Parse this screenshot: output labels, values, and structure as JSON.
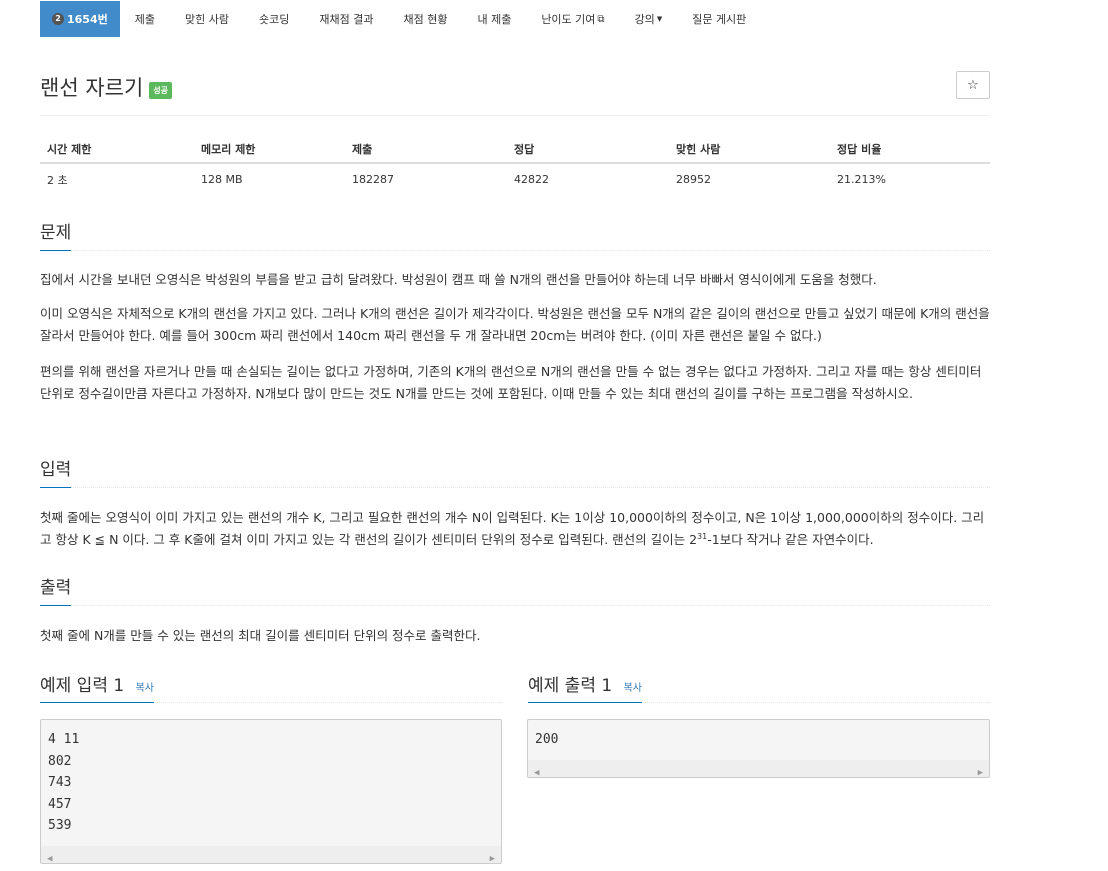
{
  "nav": {
    "problem_number": "1654번",
    "badge_icon": "tier-badge-icon",
    "items": [
      "제출",
      "맞힌 사람",
      "숏코딩",
      "재채점 결과",
      "채점 현황",
      "내 제출",
      "난이도 기여",
      "강의",
      "질문 게시판"
    ]
  },
  "title": "랜선 자르기",
  "status_label": "성공",
  "star_icon": "☆",
  "info": {
    "headers": [
      "시간 제한",
      "메모리 제한",
      "제출",
      "정답",
      "맞힌 사람",
      "정답 비율"
    ],
    "values": [
      "2 초",
      "128 MB",
      "182287",
      "42822",
      "28952",
      "21.213%"
    ]
  },
  "sections": {
    "problem": "문제",
    "input": "입력",
    "output": "출력"
  },
  "problem_paragraphs": [
    "집에서 시간을 보내던 오영식은 박성원의 부름을 받고 급히 달려왔다. 박성원이 캠프 때 쓸 N개의 랜선을 만들어야 하는데 너무 바빠서 영식이에게 도움을 청했다.",
    "이미 오영식은 자체적으로 K개의 랜선을 가지고 있다. 그러나 K개의 랜선은 길이가 제각각이다. 박성원은 랜선을 모두 N개의 같은 길이의 랜선으로 만들고 싶었기 때문에 K개의 랜선을 잘라서 만들어야 한다. 예를 들어 300cm 짜리 랜선에서 140cm 짜리 랜선을 두 개 잘라내면 20cm는 버려야 한다. (이미 자른 랜선은 붙일 수 없다.)",
    "편의를 위해 랜선을 자르거나 만들 때 손실되는 길이는 없다고 가정하며, 기존의 K개의 랜선으로 N개의 랜선을 만들 수 없는 경우는 없다고 가정하자. 그리고 자를 때는 항상 센티미터 단위로 정수길이만큼 자른다고 가정하자. N개보다 많이 만드는 것도 N개를 만드는 것에 포함된다. 이때 만들 수 있는 최대 랜선의 길이를 구하는 프로그램을 작성하시오."
  ],
  "input_text": {
    "before_sup": "첫째 줄에는 오영식이 이미 가지고 있는 랜선의 개수 K, 그리고 필요한 랜선의 개수 N이 입력된다. K는 1이상 10,000이하의 정수이고, N은 1이상 1,000,000이하의 정수이다. 그리고 항상 K ≦ N 이다. 그 후 K줄에 걸쳐 이미 가지고 있는 각 랜선의 길이가 센티미터 단위의 정수로 입력된다. 랜선의 길이는 2",
    "sup": "31",
    "after_sup": "-1보다 작거나 같은 자연수이다."
  },
  "output_text": "첫째 줄에 N개를 만들 수 있는 랜선의 최대 길이를 센티미터 단위의 정수로 출력한다.",
  "examples": {
    "input_title": "예제 입력 1",
    "output_title": "예제 출력 1",
    "copy_label": "복사",
    "input_lines": [
      "4 11",
      "802",
      "743",
      "457",
      "539"
    ],
    "output_lines": [
      "200"
    ]
  },
  "colors": {
    "nav_active": "#428bca",
    "success": "#5cb85c",
    "section_underline": "#0074c0",
    "link": "#337ab7"
  }
}
